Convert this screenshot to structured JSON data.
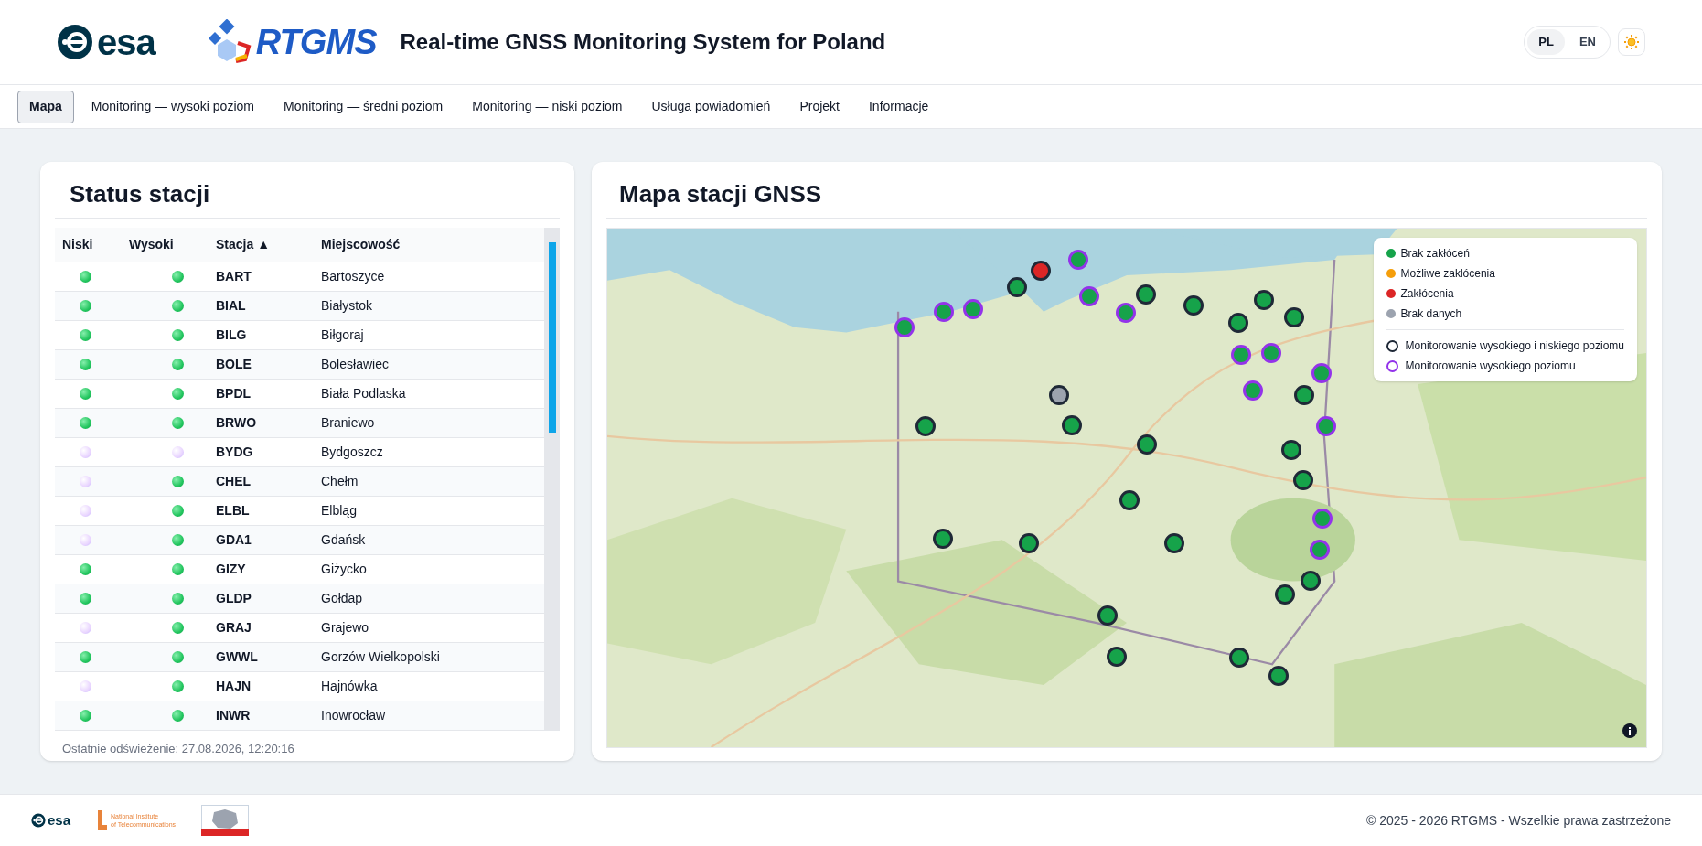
{
  "header": {
    "esa_logo": "esa",
    "rtgms_logo": "RTGMS",
    "title": "Real-time GNSS Monitoring System for Poland",
    "languages": [
      {
        "label": "PL",
        "selected": true
      },
      {
        "label": "EN",
        "selected": false
      }
    ]
  },
  "nav": [
    {
      "label": "Mapa",
      "selected": true
    },
    {
      "label": "Monitoring — wysoki poziom",
      "selected": false
    },
    {
      "label": "Monitoring — średni poziom",
      "selected": false
    },
    {
      "label": "Monitoring — niski poziom",
      "selected": false
    },
    {
      "label": "Usługa powiadomień",
      "selected": false
    },
    {
      "label": "Projekt",
      "selected": false
    },
    {
      "label": "Informacje",
      "selected": false
    }
  ],
  "station_panel": {
    "title": "Status stacji",
    "columns": [
      "Niski",
      "Wysoki",
      "Stacja ▲",
      "Miejscowość"
    ],
    "rows": [
      {
        "low_ok": true,
        "high_ok": true,
        "station": "BART",
        "city": "Bartoszyce"
      },
      {
        "low_ok": true,
        "high_ok": true,
        "station": "BIAL",
        "city": "Białystok"
      },
      {
        "low_ok": true,
        "high_ok": true,
        "station": "BILG",
        "city": "Biłgoraj"
      },
      {
        "low_ok": true,
        "high_ok": true,
        "station": "BOLE",
        "city": "Bolesławiec"
      },
      {
        "low_ok": true,
        "high_ok": true,
        "station": "BPDL",
        "city": "Biała Podlaska"
      },
      {
        "low_ok": true,
        "high_ok": true,
        "station": "BRWO",
        "city": "Braniewo"
      },
      {
        "low_ok": false,
        "high_ok": false,
        "station": "BYDG",
        "city": "Bydgoszcz"
      },
      {
        "low_ok": false,
        "high_ok": true,
        "station": "CHEL",
        "city": "Chełm"
      },
      {
        "low_ok": false,
        "high_ok": true,
        "station": "ELBL",
        "city": "Elbląg"
      },
      {
        "low_ok": false,
        "high_ok": true,
        "station": "GDA1",
        "city": "Gdańsk"
      },
      {
        "low_ok": true,
        "high_ok": true,
        "station": "GIZY",
        "city": "Giżycko"
      },
      {
        "low_ok": true,
        "high_ok": true,
        "station": "GLDP",
        "city": "Gołdap"
      },
      {
        "low_ok": false,
        "high_ok": true,
        "station": "GRAJ",
        "city": "Grajewo"
      },
      {
        "low_ok": true,
        "high_ok": true,
        "station": "GWWL",
        "city": "Gorzów Wielkopolski"
      },
      {
        "low_ok": false,
        "high_ok": true,
        "station": "HAJN",
        "city": "Hajnówka"
      },
      {
        "low_ok": true,
        "high_ok": true,
        "station": "INWR",
        "city": "Inowrocław"
      }
    ],
    "refreshed": "Ostatnie odświeżenie: 27.08.2026, 12:20:16"
  },
  "map_panel": {
    "title": "Mapa stacji GNSS",
    "legend_status": [
      {
        "label": "Brak zakłóceń",
        "color": "#16a34a"
      },
      {
        "label": "Możliwe zakłócenia",
        "color": "#f59e0b"
      },
      {
        "label": "Zakłócenia",
        "color": "#dc2626"
      },
      {
        "label": "Brak danych",
        "color": "#9ca3af"
      }
    ],
    "legend_monitoring": [
      {
        "label": "Monitorowanie wysokiego i niskiego poziomu",
        "kind": "both"
      },
      {
        "label": "Monitorowanie wysokiego poziomu",
        "kind": "high"
      }
    ],
    "markers": [
      {
        "color": "#16a34a",
        "kind": "high"
      },
      {
        "color": "#16a34a",
        "kind": "high"
      },
      {
        "color": "#16a34a",
        "kind": "high"
      },
      {
        "color": "#16a34a",
        "kind": "both"
      },
      {
        "color": "#dc2626",
        "kind": "both"
      },
      {
        "color": "#16a34a",
        "kind": "high"
      },
      {
        "color": "#16a34a",
        "kind": "high"
      },
      {
        "color": "#16a34a",
        "kind": "high"
      },
      {
        "color": "#16a34a",
        "kind": "both"
      },
      {
        "color": "#16a34a",
        "kind": "both"
      },
      {
        "color": "#16a34a",
        "kind": "both"
      },
      {
        "color": "#16a34a",
        "kind": "both"
      },
      {
        "color": "#16a34a",
        "kind": "both"
      },
      {
        "color": "#16a34a",
        "kind": "high"
      },
      {
        "color": "#16a34a",
        "kind": "high"
      },
      {
        "color": "#16a34a",
        "kind": "high"
      },
      {
        "color": "#16a34a",
        "kind": "high"
      },
      {
        "color": "#16a34a",
        "kind": "both"
      },
      {
        "color": "#9ca3af",
        "kind": "both"
      },
      {
        "color": "#16a34a",
        "kind": "both"
      },
      {
        "color": "#16a34a",
        "kind": "both"
      },
      {
        "color": "#16a34a",
        "kind": "both"
      },
      {
        "color": "#16a34a",
        "kind": "high"
      },
      {
        "color": "#16a34a",
        "kind": "both"
      },
      {
        "color": "#16a34a",
        "kind": "both"
      },
      {
        "color": "#16a34a",
        "kind": "both"
      },
      {
        "color": "#16a34a",
        "kind": "high"
      },
      {
        "color": "#16a34a",
        "kind": "both"
      },
      {
        "color": "#16a34a",
        "kind": "both"
      },
      {
        "color": "#16a34a",
        "kind": "both"
      },
      {
        "color": "#16a34a",
        "kind": "high"
      },
      {
        "color": "#16a34a",
        "kind": "both"
      },
      {
        "color": "#16a34a",
        "kind": "both"
      },
      {
        "color": "#16a34a",
        "kind": "both"
      },
      {
        "color": "#16a34a",
        "kind": "both"
      },
      {
        "color": "#16a34a",
        "kind": "both"
      },
      {
        "color": "#16a34a",
        "kind": "both"
      }
    ]
  },
  "footer": {
    "esa_logo": "esa",
    "institute_logo": [
      "National Institute",
      "of Telecommunications"
    ],
    "copyright": "© 2025 - 2026 RTGMS - Wszelkie prawa zastrzeżone"
  }
}
